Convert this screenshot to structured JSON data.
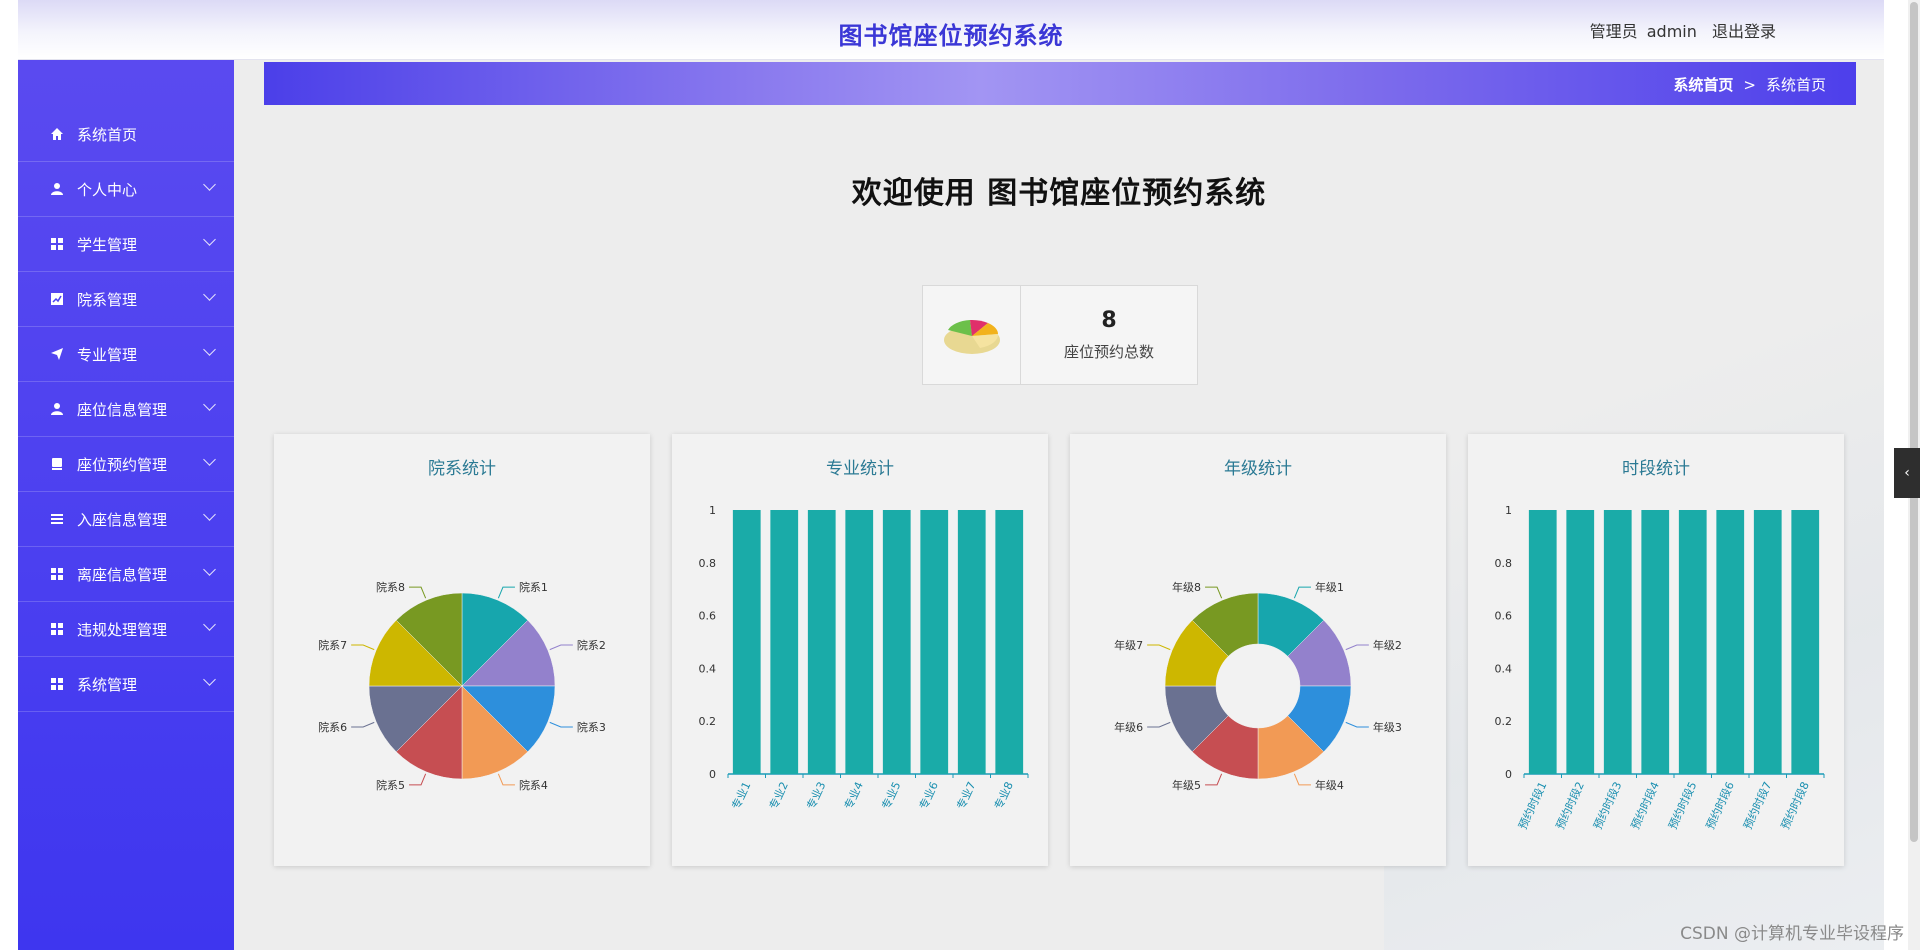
{
  "header": {
    "title": "图书馆座位预约系统",
    "role": "管理员",
    "username": "admin",
    "logout": "退出登录"
  },
  "sidebar": {
    "items": [
      {
        "label": "系统首页",
        "icon": "home-icon",
        "expandable": false
      },
      {
        "label": "个人中心",
        "icon": "user-icon",
        "expandable": true
      },
      {
        "label": "学生管理",
        "icon": "grid-icon",
        "expandable": true
      },
      {
        "label": "院系管理",
        "icon": "chart-icon",
        "expandable": true
      },
      {
        "label": "专业管理",
        "icon": "send-icon",
        "expandable": true
      },
      {
        "label": "座位信息管理",
        "icon": "user-icon",
        "expandable": true
      },
      {
        "label": "座位预约管理",
        "icon": "card-icon",
        "expandable": true
      },
      {
        "label": "入座信息管理",
        "icon": "list-icon",
        "expandable": true
      },
      {
        "label": "离座信息管理",
        "icon": "grid-icon",
        "expandable": true
      },
      {
        "label": "违规处理管理",
        "icon": "grid-icon",
        "expandable": true
      },
      {
        "label": "系统管理",
        "icon": "grid-icon",
        "expandable": true
      }
    ]
  },
  "breadcrumb": {
    "home": "系统首页",
    "separator": ">",
    "current": "系统首页"
  },
  "welcome": "欢迎使用 图书馆座位预约系统",
  "stat": {
    "value": "8",
    "label": "座位预约总数",
    "icon": "pie-chart-icon"
  },
  "cards": [
    {
      "title": "院系统计"
    },
    {
      "title": "专业统计"
    },
    {
      "title": "年级统计"
    },
    {
      "title": "时段统计"
    }
  ],
  "watermark": "CSDN @计算机专业毕设程序",
  "colors": {
    "accent": "#4a3ff0",
    "title": "#3b37d6",
    "bar": "#1aaba8",
    "chart_title": "#2b7a94"
  },
  "chart_data": [
    {
      "type": "pie",
      "title": "院系统计",
      "categories": [
        "院系1",
        "院系2",
        "院系3",
        "院系4",
        "院系5",
        "院系6",
        "院系7",
        "院系8"
      ],
      "values": [
        1,
        1,
        1,
        1,
        1,
        1,
        1,
        1
      ],
      "colors": [
        "#17a6ad",
        "#9381cc",
        "#2d8fdc",
        "#f29a55",
        "#c64e52",
        "#6a7191",
        "#cdb700",
        "#789922"
      ]
    },
    {
      "type": "bar",
      "title": "专业统计",
      "categories": [
        "专业1",
        "专业2",
        "专业3",
        "专业4",
        "专业5",
        "专业6",
        "专业7",
        "专业8"
      ],
      "values": [
        1,
        1,
        1,
        1,
        1,
        1,
        1,
        1
      ],
      "ylim": [
        0,
        1
      ],
      "yticks": [
        "0",
        "0.2",
        "0.4",
        "0.6",
        "0.8",
        "1"
      ]
    },
    {
      "type": "pie",
      "title": "年级统计",
      "donut": true,
      "categories": [
        "年级1",
        "年级2",
        "年级3",
        "年级4",
        "年级5",
        "年级6",
        "年级7",
        "年级8"
      ],
      "values": [
        1,
        1,
        1,
        1,
        1,
        1,
        1,
        1
      ],
      "colors": [
        "#17a6ad",
        "#9381cc",
        "#2d8fdc",
        "#f29a55",
        "#c64e52",
        "#6a7191",
        "#cdb700",
        "#789922"
      ]
    },
    {
      "type": "bar",
      "title": "时段统计",
      "categories": [
        "预约时段1",
        "预约时段2",
        "预约时段3",
        "预约时段4",
        "预约时段5",
        "预约时段6",
        "预约时段7",
        "预约时段8"
      ],
      "values": [
        1,
        1,
        1,
        1,
        1,
        1,
        1,
        1
      ],
      "ylim": [
        0,
        1
      ],
      "yticks": [
        "0",
        "0.2",
        "0.4",
        "0.6",
        "0.8",
        "1"
      ]
    }
  ]
}
